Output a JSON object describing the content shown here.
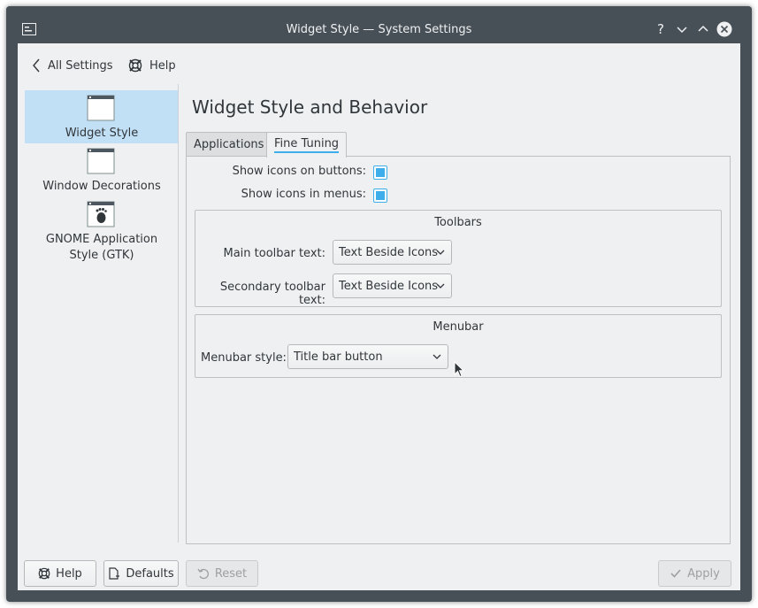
{
  "window": {
    "title": "Widget Style — System Settings"
  },
  "titlebar_buttons": [
    "help-icon",
    "minimize-icon",
    "maximize-icon",
    "close-icon"
  ],
  "titlebar_help_glyph": "?",
  "topbar": {
    "all_settings": "All Settings",
    "help": "Help"
  },
  "sidebar": {
    "items": [
      {
        "label": "Widget Style",
        "active": true
      },
      {
        "label": "Window Decorations",
        "active": false
      },
      {
        "label": "GNOME Application Style (GTK)",
        "active": false
      }
    ]
  },
  "page": {
    "title": "Widget Style and Behavior"
  },
  "tabs": [
    {
      "label": "Applications",
      "active": false
    },
    {
      "label": "Fine Tuning",
      "active": true
    }
  ],
  "fine_tuning": {
    "show_icons_on_buttons": {
      "label": "Show icons on buttons:",
      "checked": true
    },
    "show_icons_in_menus": {
      "label": "Show icons in menus:",
      "checked": true
    },
    "toolbars": {
      "title": "Toolbars",
      "main_label": "Main toolbar text:",
      "main_value": "Text Beside Icons",
      "secondary_label": "Secondary toolbar text:",
      "secondary_value": "Text Beside Icons"
    },
    "menubar": {
      "title": "Menubar",
      "style_label": "Menubar style:",
      "style_value": "Title bar button"
    }
  },
  "bottom_buttons": {
    "help": "Help",
    "defaults": "Defaults",
    "reset": "Reset",
    "apply": "Apply"
  },
  "colors": {
    "accent": "#3daee9",
    "titlebar": "#475057",
    "window_bg": "#eff0f1",
    "selection": "#c2e0f5"
  }
}
